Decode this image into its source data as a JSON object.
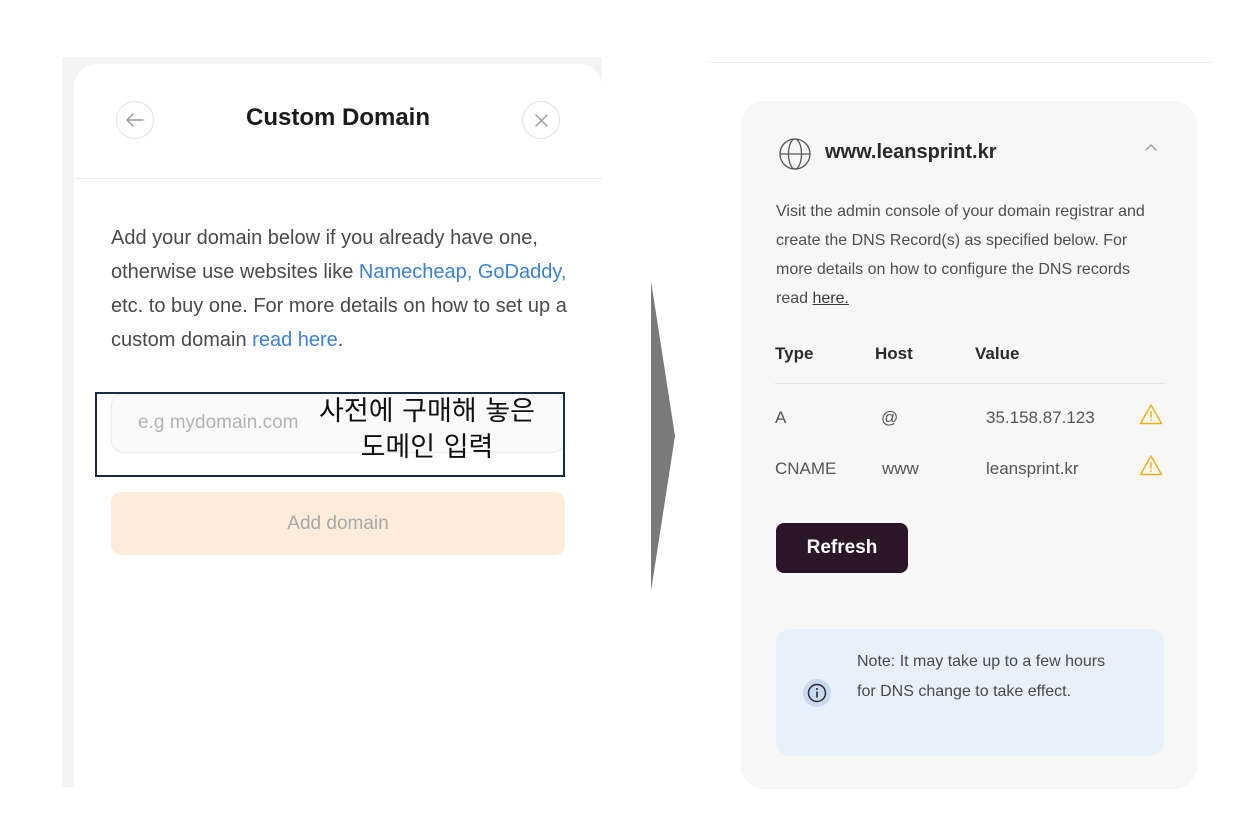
{
  "left_panel": {
    "title": "Custom Domain",
    "description": {
      "part1": "Add your domain below if you already have one, otherwise use websites like ",
      "link_namecheap": "Namecheap,",
      "part2": " ",
      "link_godaddy": "GoDaddy,",
      "part3": " etc. to buy one. For more details on how to set up a custom domain ",
      "link_read_here": "read here",
      "part4": "."
    },
    "domain_input": {
      "placeholder": "e.g mydomain.com",
      "value": ""
    },
    "add_domain_label": "Add domain",
    "annotation": "사전에 구매해 놓은\n도메인 입력",
    "icons": {
      "back": "arrow-left-icon",
      "close": "close-icon"
    }
  },
  "right_panel": {
    "domain": "www.leansprint.kr",
    "instructions": {
      "text": "Visit the admin console of your domain registrar and create the DNS Record(s) as specified below. For more details on how to configure the DNS records read ",
      "link": "here."
    },
    "table": {
      "headers": [
        "Type",
        "Host",
        "Value"
      ],
      "rows": [
        {
          "type": "A",
          "host": "@",
          "value": "35.158.87.123",
          "status_icon": "warning-icon"
        },
        {
          "type": "CNAME",
          "host": "www",
          "value": "leansprint.kr",
          "status_icon": "warning-icon"
        }
      ]
    },
    "refresh_label": "Refresh",
    "note": "Note: It may take up to a few hours for DNS change to take effect.",
    "icons": {
      "globe": "globe-icon",
      "collapse": "chevron-up-icon",
      "info": "info-icon"
    },
    "colors": {
      "refresh_bg": "#2a1628",
      "warning": "#f2b01e",
      "note_bg": "#e7f0fb",
      "link": "#3b82d6",
      "add_domain_bg": "#fdecd9"
    }
  }
}
